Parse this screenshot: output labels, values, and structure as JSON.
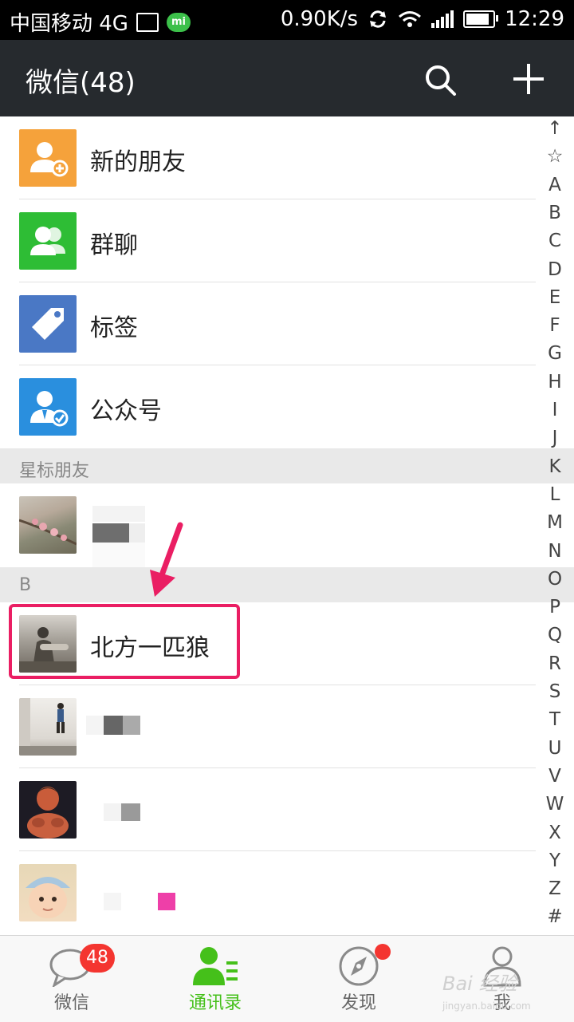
{
  "status_bar": {
    "carrier": "中国移动 4G",
    "speed": "0.90K/s",
    "time": "12:29"
  },
  "header": {
    "title": "微信(48)"
  },
  "menu_items": [
    {
      "label": "新的朋友",
      "color": "#f5a23b",
      "icon": "add-friend-icon"
    },
    {
      "label": "群聊",
      "color": "#2ebd35",
      "icon": "group-chat-icon"
    },
    {
      "label": "标签",
      "color": "#4a78c5",
      "icon": "tag-icon"
    },
    {
      "label": "公众号",
      "color": "#2a8fde",
      "icon": "official-account-icon"
    }
  ],
  "sections": {
    "starred": "星标朋友",
    "b": "B"
  },
  "contacts": {
    "highlighted": "北方一匹狼"
  },
  "index_letters": [
    "↑",
    "☆",
    "A",
    "B",
    "C",
    "D",
    "E",
    "F",
    "G",
    "H",
    "I",
    "J",
    "K",
    "L",
    "M",
    "N",
    "O",
    "P",
    "Q",
    "R",
    "S",
    "T",
    "U",
    "V",
    "W",
    "X",
    "Y",
    "Z",
    "#"
  ],
  "tabs": [
    {
      "label": "微信",
      "badge": "48",
      "icon": "chat-bubble-icon"
    },
    {
      "label": "通讯录",
      "icon": "contacts-icon",
      "active": true
    },
    {
      "label": "发现",
      "icon": "compass-icon",
      "has_dot": true
    },
    {
      "label": "我",
      "icon": "person-icon"
    }
  ],
  "watermark": {
    "text": "Bai 经验",
    "sub": "jingyan.baidu.com"
  },
  "colors": {
    "header_bg": "#262a2e",
    "accent_green": "#45c01a",
    "highlight_pink": "#ea1e63",
    "badge_red": "#f43530"
  }
}
